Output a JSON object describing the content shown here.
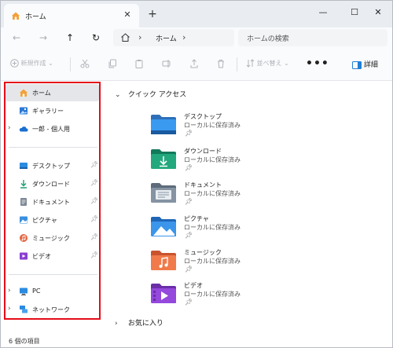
{
  "tab": {
    "title": "ホーム"
  },
  "address": {
    "crumb": "ホーム"
  },
  "search": {
    "placeholder": "ホームの検索"
  },
  "toolbar": {
    "new_label": "新規作成",
    "sort_label": "並べ替え",
    "more_label": "•••",
    "details_label": "詳細"
  },
  "sidebar": {
    "top_items": [
      {
        "label": "ホーム",
        "icon": "home-icon"
      },
      {
        "label": "ギャラリー",
        "icon": "gallery-icon"
      },
      {
        "label": "一郎 - 個人用",
        "icon": "onedrive-cloud-icon"
      }
    ],
    "pinned": [
      {
        "label": "デスクトップ",
        "icon": "desktop-folder-icon"
      },
      {
        "label": "ダウンロード",
        "icon": "download-icon"
      },
      {
        "label": "ドキュメント",
        "icon": "document-icon"
      },
      {
        "label": "ピクチャ",
        "icon": "pictures-icon"
      },
      {
        "label": "ミュージック",
        "icon": "music-icon"
      },
      {
        "label": "ビデオ",
        "icon": "video-icon"
      }
    ],
    "bottom_items": [
      {
        "label": "PC",
        "icon": "pc-icon"
      },
      {
        "label": "ネットワーク",
        "icon": "network-icon"
      }
    ]
  },
  "quick_access": {
    "heading": "クイック アクセス",
    "items": [
      {
        "name": "デスクトップ",
        "location": "ローカルに保存済み"
      },
      {
        "name": "ダウンロード",
        "location": "ローカルに保存済み"
      },
      {
        "name": "ドキュメント",
        "location": "ローカルに保存済み"
      },
      {
        "name": "ピクチャ",
        "location": "ローカルに保存済み"
      },
      {
        "name": "ミュージック",
        "location": "ローカルに保存済み"
      },
      {
        "name": "ビデオ",
        "location": "ローカルに保存済み"
      }
    ]
  },
  "favorites": {
    "heading": "お気に入り"
  },
  "status": {
    "count": "6 個の項目"
  },
  "colors": {
    "highlight_border": "#e50c18",
    "accent": "#1f7fd6"
  }
}
